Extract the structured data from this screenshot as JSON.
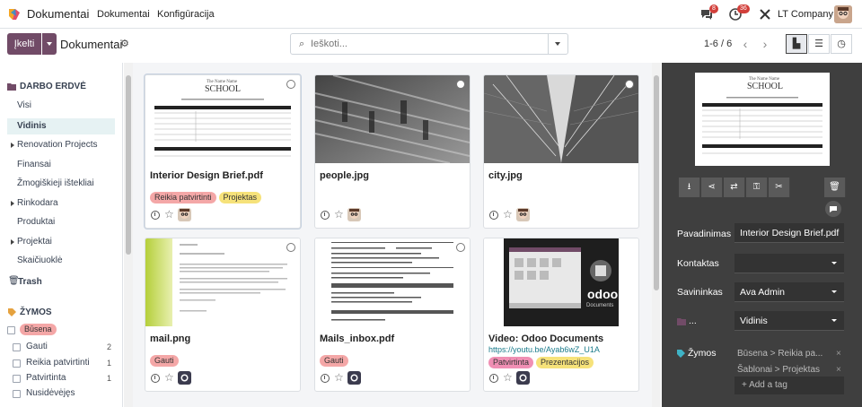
{
  "navbar": {
    "app_name": "Dokumentai",
    "menu": [
      "Dokumentai",
      "Konfigūracija"
    ],
    "messages_badge": "8",
    "activities_badge": "36",
    "company": "LT Company"
  },
  "control_panel": {
    "upload_label": "Įkelti",
    "breadcrumb": "Dokumentai",
    "search_placeholder": "Ieškoti...",
    "pager": "1-6 / 6"
  },
  "sidebar": {
    "workspace_header": "DARBO ERDVĖ",
    "folders": [
      {
        "label": "Visi"
      },
      {
        "label": "Vidinis"
      },
      {
        "label": "Renovation Projects"
      },
      {
        "label": "Finansai"
      },
      {
        "label": "Žmogiškieji ištekliai"
      },
      {
        "label": "Rinkodara"
      },
      {
        "label": "Produktai"
      },
      {
        "label": "Projektai"
      },
      {
        "label": "Skaičiuoklė"
      }
    ],
    "trash": "Trash",
    "tags_header": "ŽYMOS",
    "tag_group": "Būsena",
    "tags": [
      {
        "label": "Gauti",
        "count": "2"
      },
      {
        "label": "Reikia patvirtinti",
        "count": "1"
      },
      {
        "label": "Patvirtinta",
        "count": "1"
      },
      {
        "label": "Nusidėvėjęs",
        "count": ""
      }
    ]
  },
  "cards": [
    {
      "title": "Interior Design Brief.pdf",
      "tags": [
        "Reikia patvirtinti",
        "Projektas"
      ],
      "link": ""
    },
    {
      "title": "people.jpg",
      "tags": [],
      "link": ""
    },
    {
      "title": "city.jpg",
      "tags": [],
      "link": ""
    },
    {
      "title": "mail.png",
      "tags": [
        "Gauti"
      ],
      "link": ""
    },
    {
      "title": "Mails_inbox.pdf",
      "tags": [
        "Gauti"
      ],
      "link": ""
    },
    {
      "title": "Video: Odoo Documents",
      "tags": [
        "Patvirtinta",
        "Prezentacijos"
      ],
      "link": "https://youtu.be/Ayab6wZ_U1A"
    }
  ],
  "thumb_text": {
    "brief_header": "The Name Name",
    "brief_school": "SCHOOL",
    "odoo_logo": "odoo",
    "odoo_sub": "Documents"
  },
  "panel": {
    "name_label": "Pavadinimas",
    "name_value": "Interior Design Brief.pdf",
    "contact_label": "Kontaktas",
    "contact_value": "",
    "owner_label": "Savininkas",
    "owner_value": "Ava Admin",
    "folder_label": "...",
    "folder_value": "Vidinis",
    "tags_label": "Žymos",
    "tag_lines": [
      "Būsena > Reikia pa...",
      "Šablonai > Projektas"
    ],
    "add_tag": "+ Add a tag"
  },
  "colors": {
    "brand": "#714b67",
    "tag_red": "#f4a7a7",
    "tag_yellow": "#f6e27a",
    "tag_pink": "#f08fb4",
    "panel_bg": "#3f3f3f"
  }
}
